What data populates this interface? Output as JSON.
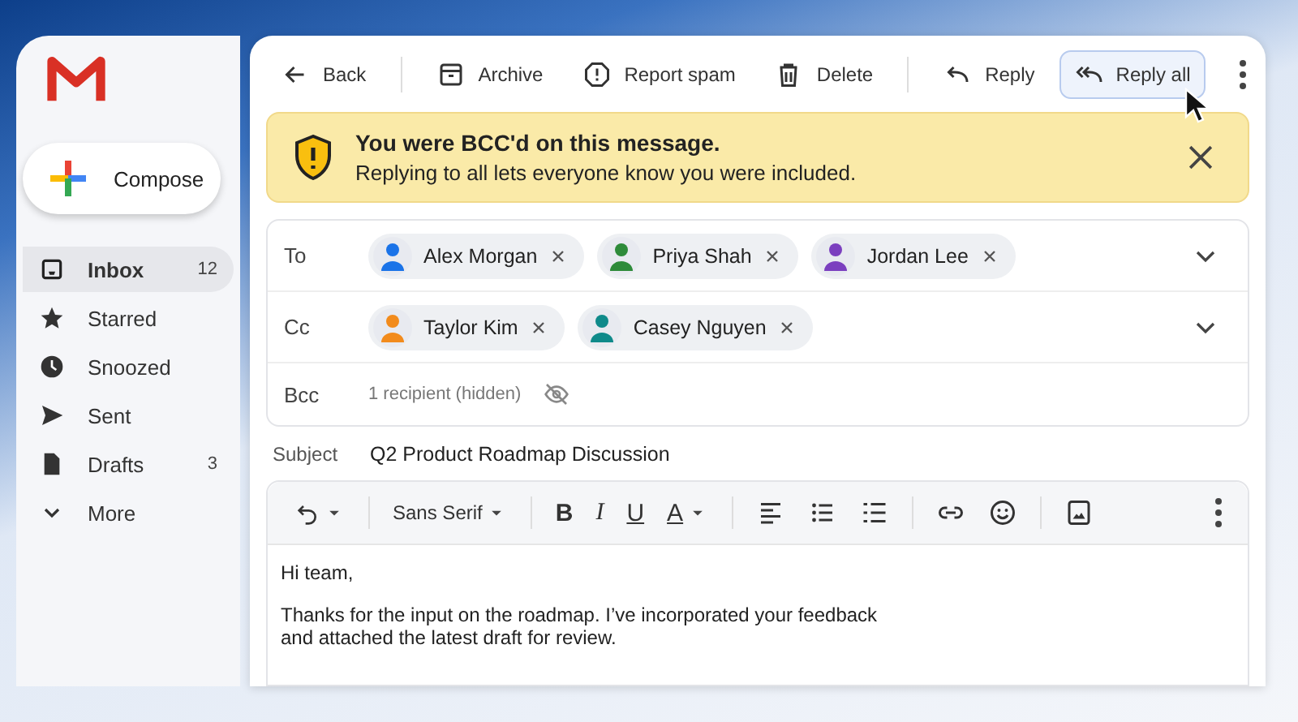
{
  "sidebar": {
    "compose": {
      "label": "Compose"
    },
    "items": [
      {
        "kind": "inbox",
        "label": "Inbox",
        "count": "12",
        "selected": true
      },
      {
        "kind": "starred",
        "label": "Starred",
        "selected": false
      },
      {
        "kind": "snoozed",
        "label": "Snoozed",
        "selected": false
      },
      {
        "kind": "sent",
        "label": "Sent",
        "selected": false
      },
      {
        "kind": "drafts",
        "label": "Drafts",
        "count": "3",
        "selected": false
      },
      {
        "kind": "more",
        "label": "More",
        "selected": false
      }
    ]
  },
  "toolbar": [
    {
      "kind": "back",
      "label": "Back",
      "selected": false
    },
    {
      "kind": "archive",
      "label": "Archive",
      "selected": false
    },
    {
      "kind": "spam",
      "label": "Report spam",
      "selected": false
    },
    {
      "kind": "delete",
      "label": "Delete",
      "selected": false
    },
    {
      "kind": "reply",
      "label": "Reply",
      "selected": false
    },
    {
      "kind": "reply_all",
      "label": "Reply all",
      "selected": true
    }
  ],
  "banner": {
    "title": "You were BCC'd on this message.",
    "message": "Replying to all lets everyone know you were included."
  },
  "recipients": [
    {
      "label": "To",
      "chips": [
        {
          "name": "Alex Morgan",
          "color": "#1a73e8"
        },
        {
          "name": "Priya Shah",
          "color": "#2e8b3a"
        },
        {
          "name": "Jordan Lee",
          "color": "#7b3fbf"
        }
      ]
    },
    {
      "label": "Cc",
      "chips": [
        {
          "name": "Taylor Kim",
          "color": "#f28b1c"
        },
        {
          "name": "Casey Nguyen",
          "color": "#0f8a8a"
        }
      ]
    },
    {
      "label": "Bcc",
      "note": "1 recipient (hidden)"
    }
  ],
  "subject": {
    "label": "Subject",
    "value": "Q2 Product Roadmap Discussion"
  },
  "editor_toolbar": [
    {
      "kind": "undo"
    },
    {
      "kind": "font",
      "label": "Sans Serif"
    },
    {
      "kind": "bold",
      "label": "B"
    },
    {
      "kind": "italic",
      "label": "I"
    },
    {
      "kind": "underline",
      "label": "U"
    },
    {
      "kind": "color",
      "label": "A"
    },
    {
      "kind": "align"
    },
    {
      "kind": "bullets"
    },
    {
      "kind": "numbers"
    },
    {
      "kind": "link"
    },
    {
      "kind": "emoji"
    },
    {
      "kind": "image"
    },
    {
      "kind": "more"
    }
  ],
  "body": [
    "Hi team,",
    "Thanks for the input on the roadmap. I’ve incorporated your feedback and attached the latest draft for review."
  ]
}
